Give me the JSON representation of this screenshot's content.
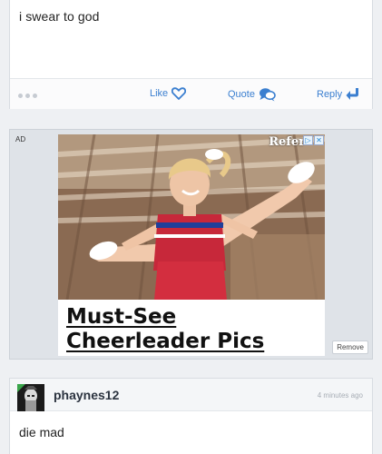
{
  "post": {
    "text": "i swear to god",
    "actions": {
      "like": "Like",
      "quote": "Quote",
      "reply": "Reply"
    }
  },
  "ad": {
    "label": "AD",
    "brand": "Refer",
    "choices": [
      "▷",
      "✕"
    ],
    "headline_line1": "Must-See ",
    "headline_line2": "Cheerleader Pics ",
    "remove": "Remove"
  },
  "post2": {
    "username": "phaynes12",
    "timestamp": "4 minutes ago",
    "text": "die mad"
  },
  "colors": {
    "accent": "#3b7fd0",
    "background": "#eef0f3",
    "avatar_badge": "#3aa54b"
  },
  "icons": [
    "more-dots-icon",
    "heart-icon",
    "quote-bubble-icon",
    "reply-arrow-icon",
    "adchoices-icon",
    "close-icon"
  ]
}
